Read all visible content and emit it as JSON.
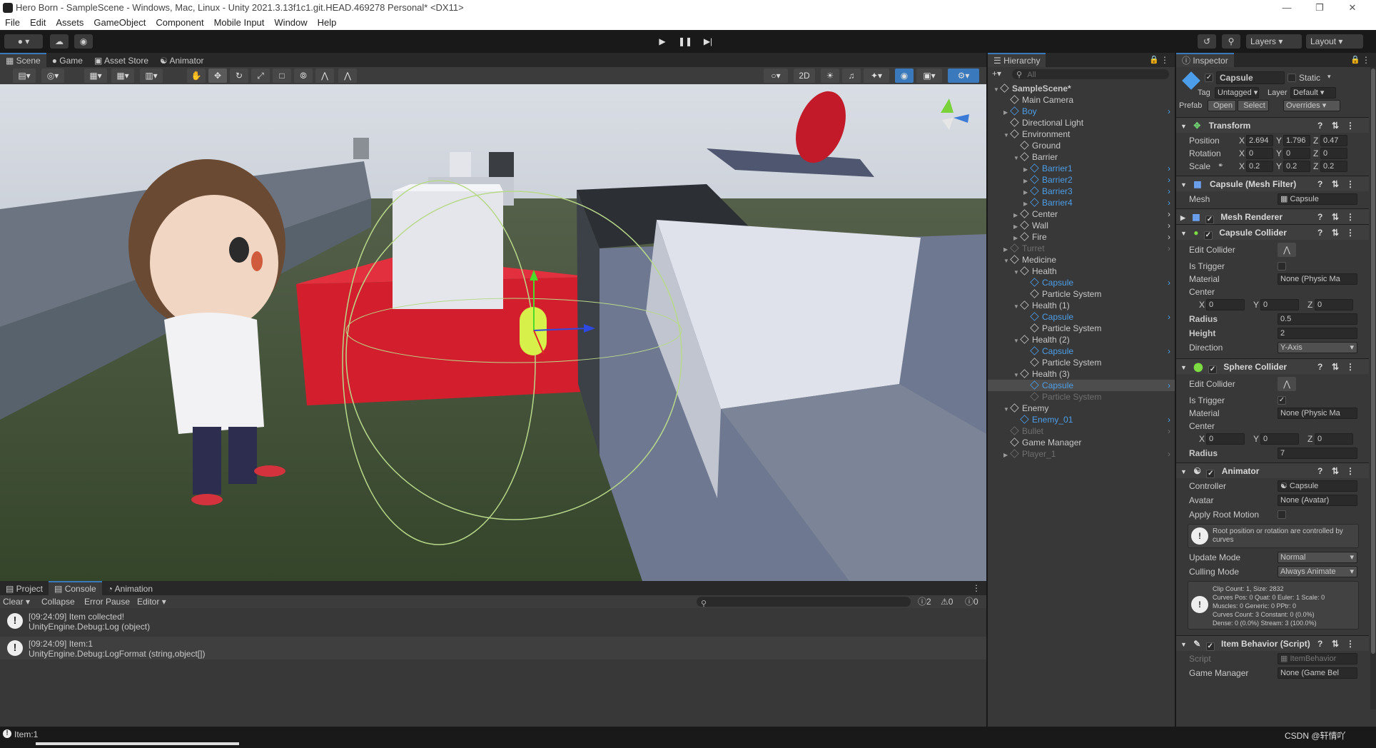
{
  "window": {
    "title": "Hero Born - SampleScene - Windows, Mac, Linux - Unity 2021.3.13f1c1.git.HEAD.469278 Personal* <DX11>"
  },
  "menu": [
    "File",
    "Edit",
    "Assets",
    "GameObject",
    "Component",
    "Mobile Input",
    "Window",
    "Help"
  ],
  "toolbar": {
    "layers": "Layers",
    "layout": "Layout"
  },
  "scene_tabs": [
    "Scene",
    "Game",
    "Asset Store",
    "Animator"
  ],
  "scene_tools": {
    "mode_2d": "2D"
  },
  "hierarchy": {
    "tab": "Hierarchy",
    "search_placeholder": "All",
    "rows": [
      {
        "label": "SampleScene*",
        "depth": 0,
        "style": "bold",
        "expand": "down"
      },
      {
        "label": "Main Camera",
        "depth": 1,
        "style": "",
        "expand": ""
      },
      {
        "label": "Boy",
        "depth": 1,
        "style": "blue",
        "expand": "right"
      },
      {
        "label": "Directional Light",
        "depth": 1,
        "style": "",
        "expand": ""
      },
      {
        "label": "Environment",
        "depth": 1,
        "style": "",
        "expand": "down"
      },
      {
        "label": "Ground",
        "depth": 2,
        "style": "",
        "expand": ""
      },
      {
        "label": "Barrier",
        "depth": 2,
        "style": "",
        "expand": "down"
      },
      {
        "label": "Barrier1",
        "depth": 3,
        "style": "blue",
        "expand": "right"
      },
      {
        "label": "Barrier2",
        "depth": 3,
        "style": "blue",
        "expand": "right"
      },
      {
        "label": "Barrier3",
        "depth": 3,
        "style": "blue",
        "expand": "right"
      },
      {
        "label": "Barrier4",
        "depth": 3,
        "style": "blue",
        "expand": "right"
      },
      {
        "label": "Center",
        "depth": 2,
        "style": "",
        "expand": "right"
      },
      {
        "label": "Wall",
        "depth": 2,
        "style": "",
        "expand": "right"
      },
      {
        "label": "Fire",
        "depth": 2,
        "style": "",
        "expand": "right"
      },
      {
        "label": "Turret",
        "depth": 1,
        "style": "faded",
        "expand": "right"
      },
      {
        "label": "Medicine",
        "depth": 1,
        "style": "",
        "expand": "down"
      },
      {
        "label": "Health",
        "depth": 2,
        "style": "",
        "expand": "down"
      },
      {
        "label": "Capsule",
        "depth": 3,
        "style": "blue",
        "expand": ""
      },
      {
        "label": "Particle System",
        "depth": 3,
        "style": "",
        "expand": ""
      },
      {
        "label": "Health (1)",
        "depth": 2,
        "style": "",
        "expand": "down"
      },
      {
        "label": "Capsule",
        "depth": 3,
        "style": "blue",
        "expand": ""
      },
      {
        "label": "Particle System",
        "depth": 3,
        "style": "",
        "expand": ""
      },
      {
        "label": "Health (2)",
        "depth": 2,
        "style": "",
        "expand": "down"
      },
      {
        "label": "Capsule",
        "depth": 3,
        "style": "blue",
        "expand": ""
      },
      {
        "label": "Particle System",
        "depth": 3,
        "style": "",
        "expand": ""
      },
      {
        "label": "Health (3)",
        "depth": 2,
        "style": "",
        "expand": "down"
      },
      {
        "label": "Capsule",
        "depth": 3,
        "style": "blue sel",
        "expand": ""
      },
      {
        "label": "Particle System",
        "depth": 3,
        "style": "faded",
        "expand": ""
      },
      {
        "label": "Enemy",
        "depth": 1,
        "style": "",
        "expand": "down"
      },
      {
        "label": "Enemy_01",
        "depth": 2,
        "style": "blue",
        "expand": ""
      },
      {
        "label": "Bullet",
        "depth": 1,
        "style": "faded blue",
        "expand": ""
      },
      {
        "label": "Game Manager",
        "depth": 1,
        "style": "",
        "expand": ""
      },
      {
        "label": "Player_1",
        "depth": 1,
        "style": "faded",
        "expand": "right"
      }
    ]
  },
  "inspector": {
    "tab": "Inspector",
    "object_name": "Capsule",
    "static_label": "Static",
    "tag_label": "Tag",
    "tag_value": "Untagged",
    "layer_label": "Layer",
    "layer_value": "Default",
    "prefab_label": "Prefab",
    "open_label": "Open",
    "select_label": "Select",
    "overrides_label": "Overrides",
    "transform": {
      "title": "Transform",
      "position_label": "Position",
      "rotation_label": "Rotation",
      "scale_label": "Scale",
      "position": [
        "2.694",
        "1.796",
        "0.47"
      ],
      "rotation": [
        "0",
        "0",
        "0"
      ],
      "scale": [
        "0.2",
        "0.2",
        "0.2"
      ]
    },
    "mesh_filter": {
      "title": "Capsule (Mesh Filter)",
      "mesh_label": "Mesh",
      "mesh_value": "Capsule"
    },
    "mesh_renderer": {
      "title": "Mesh Renderer"
    },
    "capsule_collider": {
      "title": "Capsule Collider",
      "edit_label": "Edit Collider",
      "trigger_label": "Is Trigger",
      "material_label": "Material",
      "material_value": "None (Physic Ma",
      "center_label": "Center",
      "center": [
        "0",
        "0",
        "0"
      ],
      "radius_label": "Radius",
      "radius": "0.5",
      "height_label": "Height",
      "height": "2",
      "direction_label": "Direction",
      "direction": "Y-Axis"
    },
    "sphere_collider": {
      "title": "Sphere Collider",
      "edit_label": "Edit Collider",
      "trigger_label": "Is Trigger",
      "material_label": "Material",
      "material_value": "None (Physic Ma",
      "center_label": "Center",
      "center": [
        "0",
        "0",
        "0"
      ],
      "radius_label": "Radius",
      "radius": "7"
    },
    "animator": {
      "title": "Animator",
      "controller_label": "Controller",
      "controller_value": "Capsule",
      "avatar_label": "Avatar",
      "avatar_value": "None (Avatar)",
      "root_label": "Apply Root Motion",
      "info": "Root position or rotation are controlled by curves",
      "update_label": "Update Mode",
      "update_value": "Normal",
      "culling_label": "Culling Mode",
      "culling_value": "Always Animate",
      "clip_info": [
        "Clip Count: 1, Size: 2832",
        "Curves Pos: 0 Quat: 0 Euler: 1 Scale: 0",
        "Muscles: 0 Generic: 0 PPtr: 0",
        "Curves Count: 3 Constant: 0 (0.0%)",
        "Dense: 0 (0.0%) Stream: 3 (100.0%)"
      ]
    },
    "item_behavior": {
      "title": "Item Behavior (Script)",
      "script_label": "Script",
      "script_value": "ItemBehavior",
      "gm_label": "Game Manager",
      "gm_value": "None (Game Bel"
    }
  },
  "console": {
    "tabs": [
      "Project",
      "Console",
      "Animation"
    ],
    "clear": "Clear",
    "collapse": "Collapse",
    "error_pause": "Error Pause",
    "editor": "Editor",
    "count_log": "2",
    "count_warn": "0",
    "count_err": "0",
    "logs": [
      {
        "line1": "[09:24:09] Item collected!",
        "line2": "UnityEngine.Debug:Log (object)"
      },
      {
        "line1": "[09:24:09] Item:1",
        "line2": "UnityEngine.Debug:LogFormat (string,object[])"
      }
    ]
  },
  "status": {
    "message": "Item:1",
    "watermark": "CSDN @轩情吖"
  }
}
